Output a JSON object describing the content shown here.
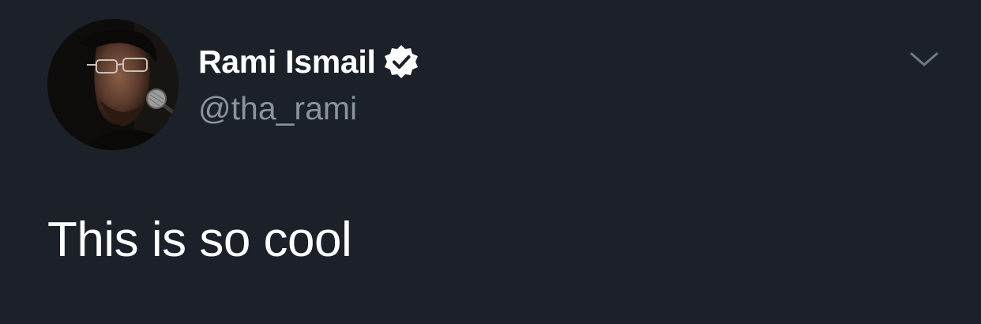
{
  "tweet": {
    "author": {
      "display_name": "Rami Ismail",
      "handle": "@tha_rami",
      "verified": true,
      "verified_icon": "verified-badge-icon",
      "avatar_icon": "profile-photo"
    },
    "text": "This is so cool",
    "menu_icon": "chevron-down-icon"
  },
  "colors": {
    "background": "#1b2029",
    "primary_text": "#ffffff",
    "secondary_text": "#8a949f",
    "chevron": "#6e7a85"
  }
}
